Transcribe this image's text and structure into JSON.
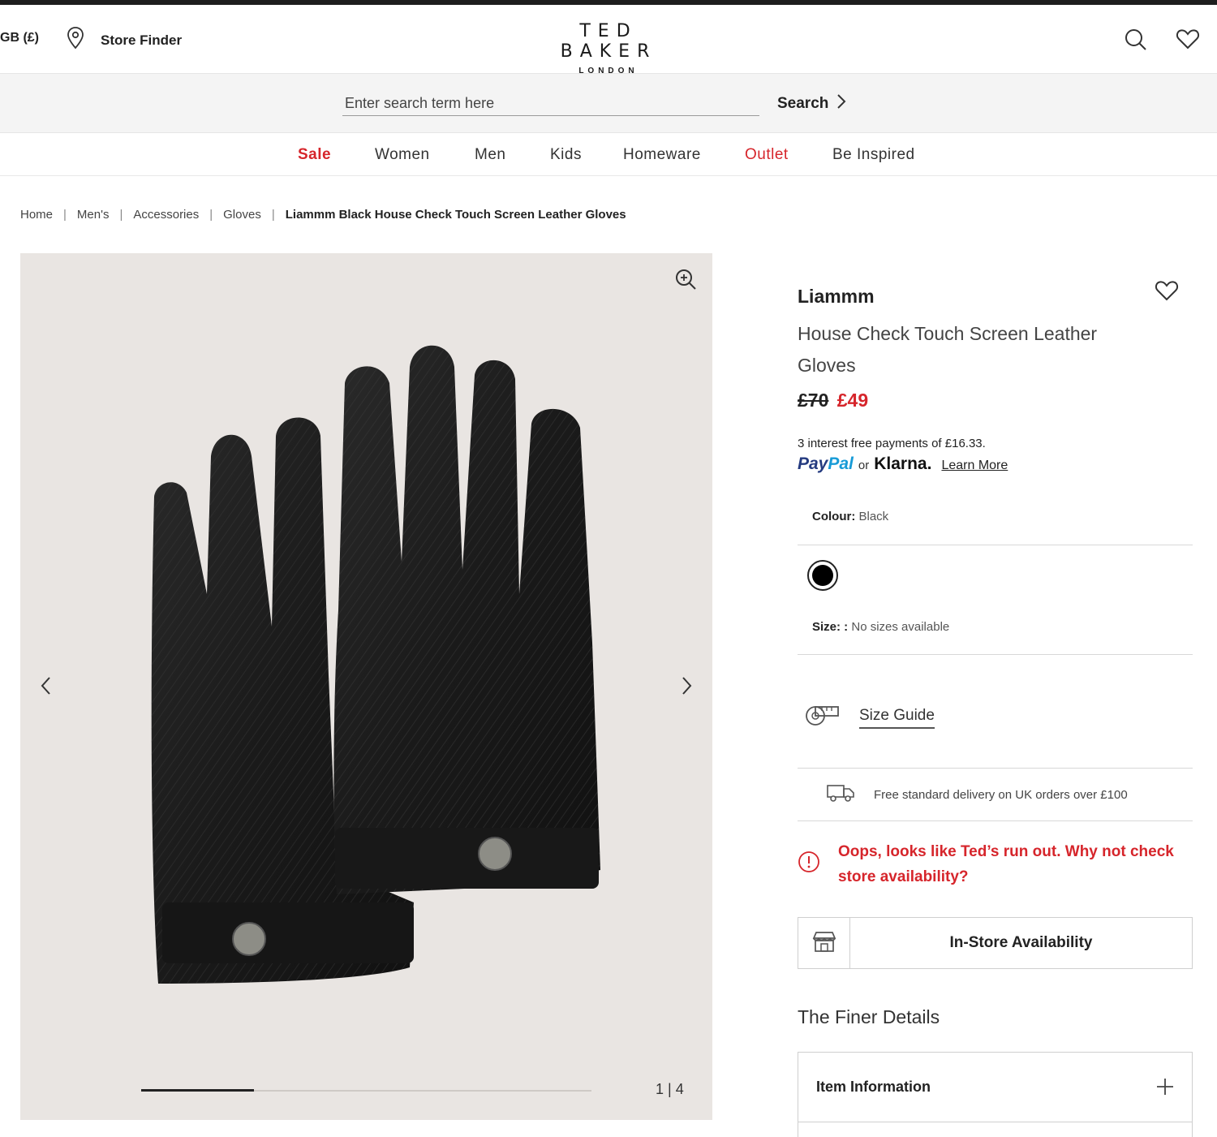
{
  "header": {
    "locale": "GB (£)",
    "store_finder": "Store Finder",
    "brand": "TED BAKER",
    "brand_city": "LONDON",
    "icons": [
      "location-pin-icon",
      "search-icon",
      "heart-icon"
    ]
  },
  "search": {
    "placeholder": "Enter search term here",
    "button_label": "Search"
  },
  "nav": {
    "items": [
      {
        "label": "Sale",
        "color": "#d6252b"
      },
      {
        "label": "Women"
      },
      {
        "label": "Men"
      },
      {
        "label": "Kids"
      },
      {
        "label": "Homeware"
      },
      {
        "label": "Outlet",
        "color": "#d6252b"
      },
      {
        "label": "Be Inspired"
      }
    ]
  },
  "breadcrumb": {
    "items": [
      "Home",
      "Men's",
      "Accessories",
      "Gloves"
    ],
    "current": "Liammm Black House Check Touch Screen Leather Gloves"
  },
  "gallery": {
    "counter": "1 | 4",
    "current_index": 1,
    "total": 4,
    "progress": 0.25
  },
  "product": {
    "name": "Liammm",
    "subtitle": "House Check Touch Screen Leather Gloves",
    "price_old": "£70",
    "price_new": "£49",
    "installments": "3 interest free payments of £16.33.",
    "paypal_1": "Pay",
    "paypal_2": "Pal",
    "or": "or",
    "klarna": "Klarna.",
    "learn_more": "Learn More",
    "colour_label": "Colour:",
    "colour_value": "Black",
    "swatch_color": "#000000",
    "size_label": "Size: :",
    "size_value": "No sizes available",
    "size_guide": "Size Guide",
    "delivery": "Free standard delivery on UK orders over £100",
    "oos_message": "Oops, looks like Ted’s run out. Why not check store availability?",
    "instore": "In-Store Availability",
    "finer_details": "The Finer Details",
    "item_information": "Item Information"
  },
  "colors": {
    "accent_red": "#d6252b",
    "paypal_dark": "#253b80",
    "paypal_light": "#179bd7",
    "image_bg": "#e9e5e2"
  }
}
